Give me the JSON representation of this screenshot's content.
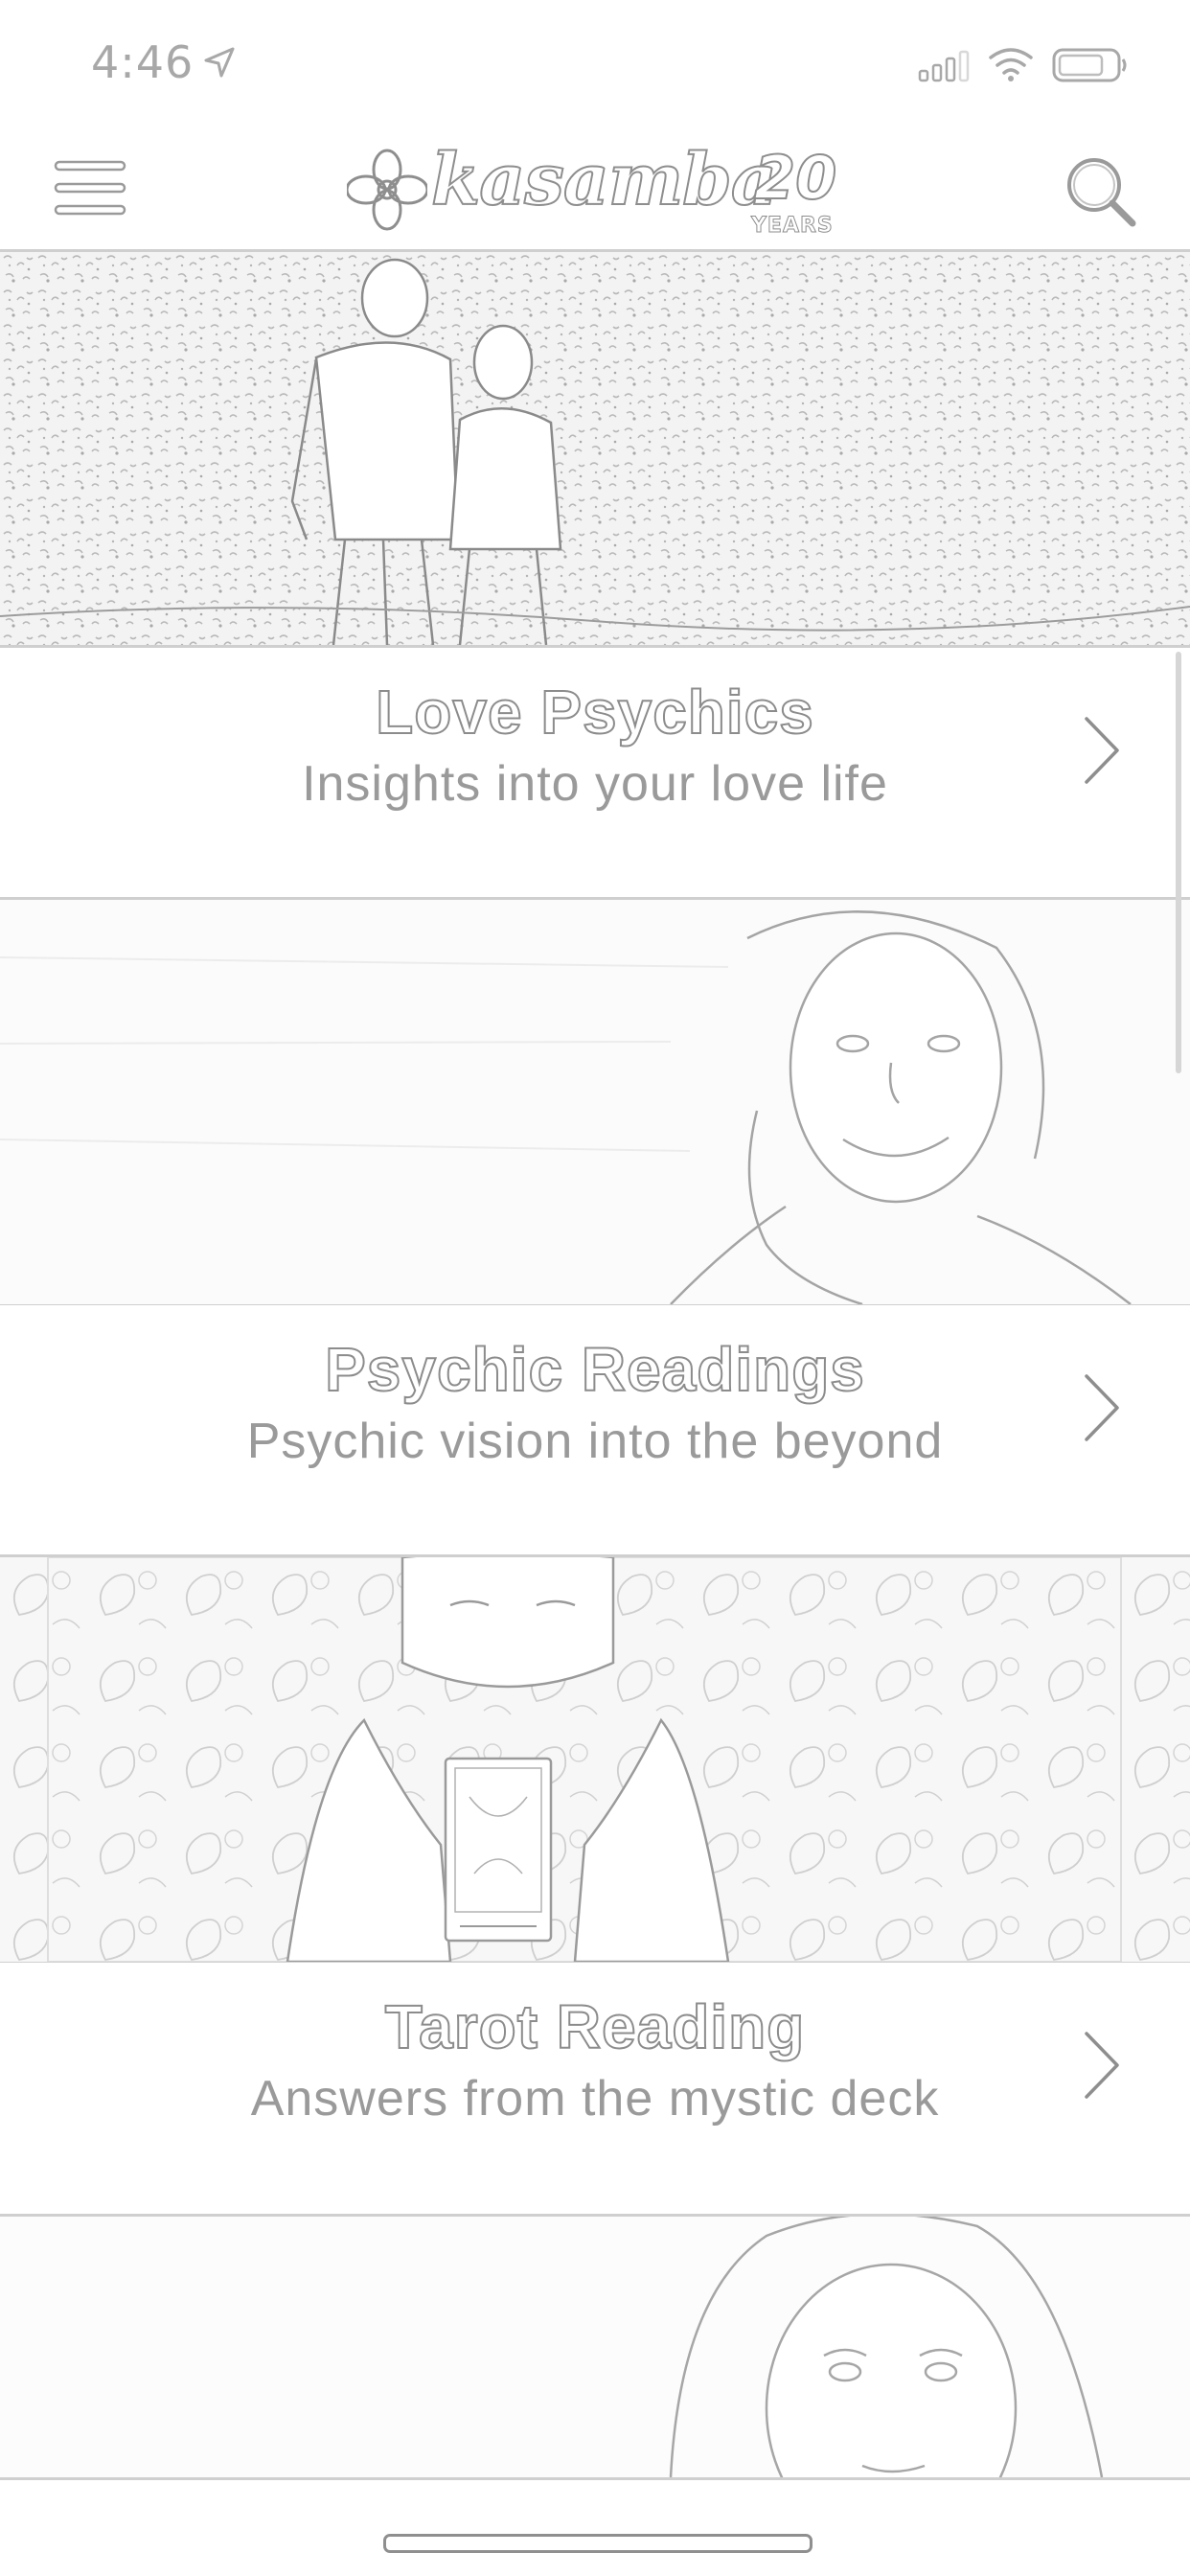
{
  "status_bar": {
    "time": "4:46",
    "location_icon": "location-arrow-icon",
    "signal_icon": "cellular-signal-icon",
    "wifi_icon": "wifi-icon",
    "battery_icon": "battery-icon"
  },
  "header": {
    "menu_icon": "hamburger-menu-icon",
    "logo_text": "kasamba",
    "logo_years_number": "20",
    "logo_years_word": "YEARS",
    "search_icon": "search-icon"
  },
  "categories": [
    {
      "title": "Love Psychics",
      "subtitle": "Insights into your love life",
      "banner": "couple-walking-photo"
    },
    {
      "title": "Psychic Readings",
      "subtitle": "Psychic vision into the beyond",
      "banner": "smiling-woman-photo"
    },
    {
      "title": "Tarot Reading",
      "subtitle": "Answers from the mystic deck",
      "banner": "tarot-card-photo"
    }
  ],
  "next_banner": "woman-portrait-photo",
  "colors": {
    "outline": "#8c8c8c",
    "subtitle": "#9a9a9a",
    "divider": "#cfcfcf",
    "background": "#ffffff"
  }
}
